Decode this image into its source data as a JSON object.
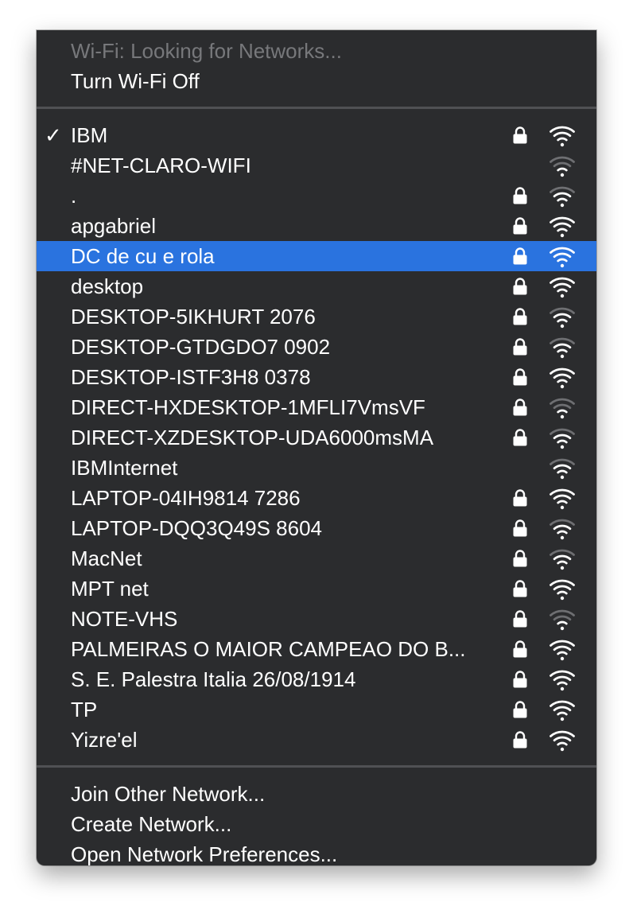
{
  "wifi_menu": {
    "status_label": "Wi-Fi: Looking for Networks...",
    "toggle_label": "Turn Wi-Fi Off",
    "networks": [
      {
        "name": "IBM",
        "connected": true,
        "locked": true,
        "signal": 3
      },
      {
        "name": "#NET-CLARO-WIFI",
        "connected": false,
        "locked": false,
        "signal": 1
      },
      {
        "name": ".",
        "connected": false,
        "locked": true,
        "signal": 2
      },
      {
        "name": "apgabriel",
        "connected": false,
        "locked": true,
        "signal": 3
      },
      {
        "name": "DC de cu e rola",
        "connected": false,
        "locked": true,
        "signal": 3,
        "highlighted": true
      },
      {
        "name": "desktop",
        "connected": false,
        "locked": true,
        "signal": 3
      },
      {
        "name": "DESKTOP-5IKHURT 2076",
        "connected": false,
        "locked": true,
        "signal": 2
      },
      {
        "name": "DESKTOP-GTDGDO7 0902",
        "connected": false,
        "locked": true,
        "signal": 2
      },
      {
        "name": "DESKTOP-ISTF3H8 0378",
        "connected": false,
        "locked": true,
        "signal": 3
      },
      {
        "name": "DIRECT-HXDESKTOP-1MFLI7VmsVF",
        "connected": false,
        "locked": true,
        "signal": 1
      },
      {
        "name": "DIRECT-XZDESKTOP-UDA6000msMA",
        "connected": false,
        "locked": true,
        "signal": 2
      },
      {
        "name": "IBMInternet",
        "connected": false,
        "locked": false,
        "signal": 2
      },
      {
        "name": "LAPTOP-04IH9814 7286",
        "connected": false,
        "locked": true,
        "signal": 3
      },
      {
        "name": "LAPTOP-DQQ3Q49S 8604",
        "connected": false,
        "locked": true,
        "signal": 2
      },
      {
        "name": "MacNet",
        "connected": false,
        "locked": true,
        "signal": 2
      },
      {
        "name": "MPT net",
        "connected": false,
        "locked": true,
        "signal": 3
      },
      {
        "name": "NOTE-VHS",
        "connected": false,
        "locked": true,
        "signal": 1
      },
      {
        "name": "PALMEIRAS O MAIOR CAMPEAO DO B...",
        "connected": false,
        "locked": true,
        "signal": 3
      },
      {
        "name": "S. E. Palestra Italia 26/08/1914",
        "connected": false,
        "locked": true,
        "signal": 3
      },
      {
        "name": "TP",
        "connected": false,
        "locked": true,
        "signal": 3
      },
      {
        "name": "Yizre'el",
        "connected": false,
        "locked": true,
        "signal": 3
      }
    ],
    "footer_items": [
      "Join Other Network...",
      "Create Network...",
      "Open Network Preferences..."
    ],
    "checkmark": "✓",
    "colors": {
      "menu_bg": "#2b2c2e",
      "highlight": "#2a73df",
      "text": "#ffffff",
      "disabled_text": "#77787b",
      "dim_arc": "#6e6f72"
    },
    "icons": {
      "lock": "lock-icon",
      "wifi": "wifi-signal-icon",
      "check": "checkmark-icon"
    }
  }
}
